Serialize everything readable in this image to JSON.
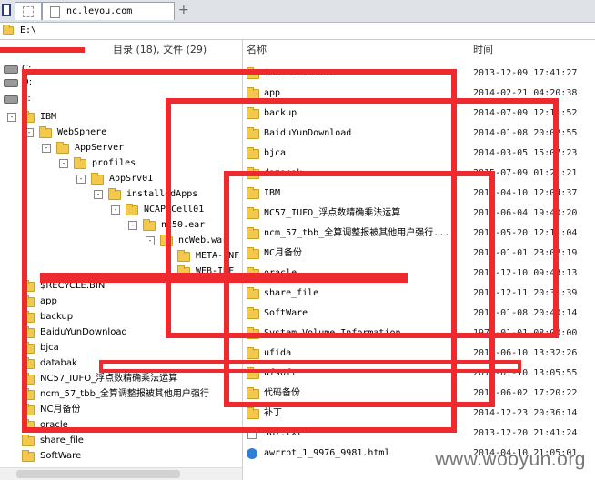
{
  "tabs": [
    {
      "label": ""
    },
    {
      "label": "nc.leyou.com"
    }
  ],
  "new_tab_glyph": "+",
  "address": "E:\\",
  "left_header": "目录 (18), 文件 (29)",
  "right_header": {
    "name": "名称",
    "time": "时间"
  },
  "tree": [
    {
      "label": "C:",
      "toggle": ""
    },
    {
      "label": "D:",
      "toggle": ""
    },
    {
      "label": "E:",
      "toggle": ""
    },
    {
      "label": "IBM",
      "toggle": "-"
    },
    {
      "label": "WebSphere",
      "toggle": "-"
    },
    {
      "label": "AppServer",
      "toggle": "-"
    },
    {
      "label": "profiles",
      "toggle": "-"
    },
    {
      "label": "AppSrv01",
      "toggle": "-"
    },
    {
      "label": "installedApps",
      "toggle": "-"
    },
    {
      "label": "NCAPPCell01",
      "toggle": "-"
    },
    {
      "label": "nc50.ear",
      "toggle": "-"
    },
    {
      "label": "ncWeb.war",
      "toggle": "-"
    },
    {
      "label": "META-INF",
      "toggle": ""
    },
    {
      "label": "WEB-INF",
      "toggle": ""
    },
    {
      "label": "$RECYCLE.BIN",
      "toggle": ""
    },
    {
      "label": "app",
      "toggle": ""
    },
    {
      "label": "backup",
      "toggle": ""
    },
    {
      "label": "BaiduYunDownload",
      "toggle": ""
    },
    {
      "label": "bjca",
      "toggle": ""
    },
    {
      "label": "databak",
      "toggle": ""
    },
    {
      "label": "NC57_IUFO_浮点数精确乘法运算",
      "toggle": ""
    },
    {
      "label": "ncm_57_tbb_全算调整报被其他用户强行",
      "toggle": ""
    },
    {
      "label": "NC月备份",
      "toggle": ""
    },
    {
      "label": "oracle",
      "toggle": ""
    },
    {
      "label": "share_file",
      "toggle": ""
    },
    {
      "label": "SoftWare",
      "toggle": ""
    }
  ],
  "files": [
    {
      "name": "$RECYCLE.BIN",
      "time": "2013-12-09 17:41:27",
      "type": "folder"
    },
    {
      "name": "app",
      "time": "2014-02-21 04:20:38",
      "type": "folder"
    },
    {
      "name": "backup",
      "time": "2014-07-09 12:11:52",
      "type": "folder"
    },
    {
      "name": "BaiduYunDownload",
      "time": "2014-01-08 20:02:55",
      "type": "folder"
    },
    {
      "name": "bjca",
      "time": "2014-03-05 15:07:23",
      "type": "folder"
    },
    {
      "name": "databak",
      "time": "2015-07-09 01:21:21",
      "type": "folder"
    },
    {
      "name": "IBM",
      "time": "2014-04-10 12:04:37",
      "type": "folder"
    },
    {
      "name": "NC57_IUFO_浮点数精确乘法运算",
      "time": "2014-06-04 19:40:20",
      "type": "folder"
    },
    {
      "name": "ncm_57_tbb_全算调整报被其他用户强行...",
      "time": "2014-05-20 12:11:04",
      "type": "folder"
    },
    {
      "name": "NC月备份",
      "time": "2014-01-01 23:02:19",
      "type": "folder"
    },
    {
      "name": "oracle",
      "time": "2014-12-10 09:43:13",
      "type": "folder"
    },
    {
      "name": "share_file",
      "time": "2014-12-11 20:31:39",
      "type": "folder"
    },
    {
      "name": "SoftWare",
      "time": "2014-01-08 20:40:14",
      "type": "folder"
    },
    {
      "name": "System Volume Information",
      "time": "1970-01-01 08:00:00",
      "type": "folder"
    },
    {
      "name": "ufida",
      "time": "2014-06-10 13:32:26",
      "type": "folder"
    },
    {
      "name": "ufsoft",
      "time": "2014-01-10 13:05:55",
      "type": "folder"
    },
    {
      "name": "代码备份",
      "time": "2014-06-02 17:20:22",
      "type": "folder"
    },
    {
      "name": "补丁",
      "time": "2014-12-23 20:36:14",
      "type": "folder"
    },
    {
      "name": "3G7.txt",
      "time": "2013-12-20 21:41:24",
      "type": "file"
    },
    {
      "name": "awrrpt_1_9976_9981.html",
      "time": "2014-04-10 21:05:01",
      "type": "html"
    }
  ],
  "watermark": "www.wooyun.org",
  "colors": {
    "redaction": "#ee2a2e",
    "folder": "#f2c94c"
  }
}
